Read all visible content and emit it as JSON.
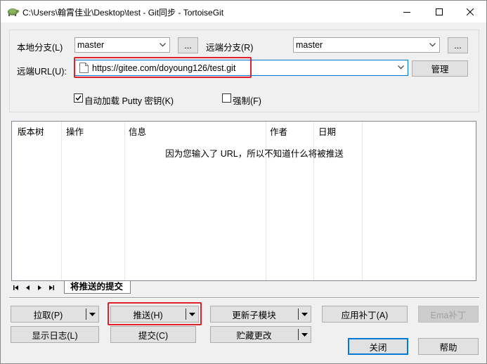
{
  "window": {
    "title": "C:\\Users\\翰霄佳业\\Desktop\\test - Git同步 - TortoiseGit",
    "icon": "tortoisegit-icon"
  },
  "colors": {
    "highlight": "#e0202a",
    "focus": "#0078d7"
  },
  "form": {
    "local_branch_label": "本地分支(L)",
    "local_branch_value": "master",
    "browse_local": "...",
    "remote_branch_label": "远端分支(R)",
    "remote_branch_value": "master",
    "browse_remote": "...",
    "remote_url_label": "远端URL(U):",
    "remote_url_value": "https://gitee.com/doyoung126/test.git",
    "manage_button": "管理",
    "autoload_putty_label": "自动加载 Putty 密钥(K)",
    "autoload_putty_checked": true,
    "force_label": "强制(F)",
    "force_checked": false
  },
  "list": {
    "columns": [
      "版本树",
      "操作",
      "信息",
      "作者",
      "日期"
    ],
    "empty_message": "因为您输入了 URL，所以不知道什么将被推送"
  },
  "tabs": {
    "active": "将推送的提交"
  },
  "buttons": {
    "pull": "拉取(P)",
    "push": "推送(H)",
    "update_submodules": "更新子模块",
    "apply_patch": "应用补丁(A)",
    "email_patch": "Ema补丁",
    "show_log": "显示日志(L)",
    "commit": "提交(C)",
    "stash": "贮藏更改",
    "close": "关闭",
    "help": "帮助"
  }
}
